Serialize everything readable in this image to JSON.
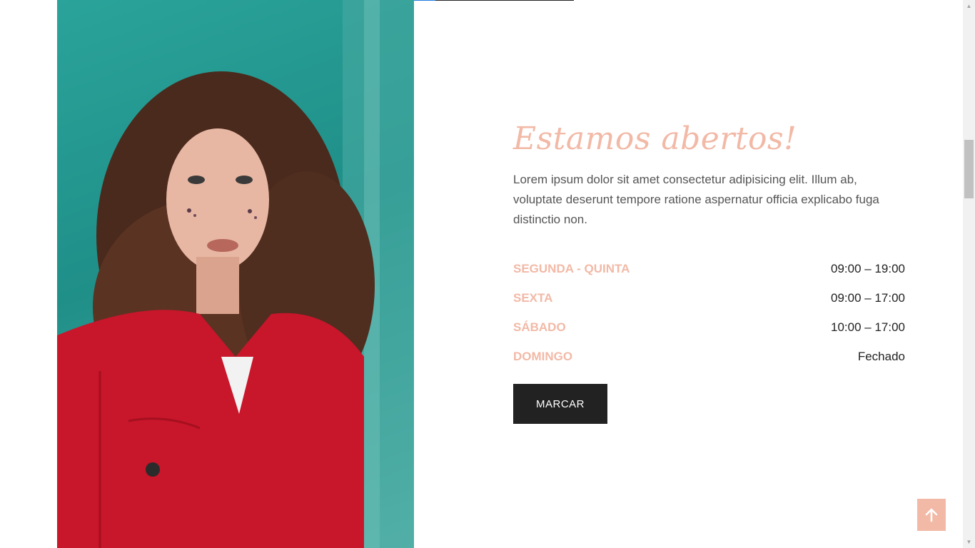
{
  "hero": {
    "image_alt": "Mulher de cabelo cacheado com jaqueta vermelha",
    "heading": "Estamos abertos!",
    "intro": "Lorem ipsum dolor sit amet consectetur adipisicing elit. Illum ab, voluptate deserunt tempore ratione aspernatur officia explicabo fuga distinctio non.",
    "hours": [
      {
        "day": "SEGUNDA - QUINTA",
        "time": "09:00 – 19:00"
      },
      {
        "day": "SEXTA",
        "time": "09:00 – 17:00"
      },
      {
        "day": "SÁBADO",
        "time": "10:00 – 17:00"
      },
      {
        "day": "DOMINGO",
        "time": "Fechado"
      }
    ],
    "button_label": "MARCAR"
  },
  "colors": {
    "accent": "#f2b9a6",
    "dark": "#222222",
    "text": "#555555",
    "photo_bg": "#2aa39a"
  },
  "icons": {
    "back_to_top": "arrow-up-icon"
  }
}
